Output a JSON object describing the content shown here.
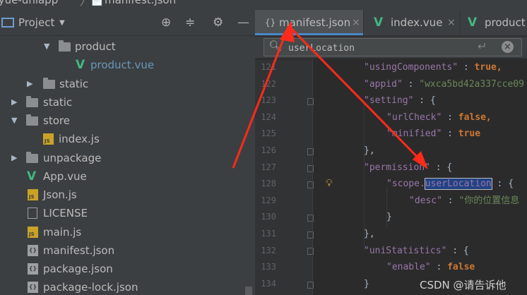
{
  "titlebar": {
    "project_name": "kaiyue-uniapp",
    "file_name": "manifest.json"
  },
  "project_pane": {
    "title": "Project",
    "tree": [
      {
        "label": "product",
        "kind": "folder",
        "expanded": true
      },
      {
        "label": "product.vue",
        "kind": "vue",
        "selected": true
      },
      {
        "label": "static",
        "kind": "folder",
        "expanded": false
      },
      {
        "label": "static",
        "kind": "folder",
        "expanded": false
      },
      {
        "label": "store",
        "kind": "folder",
        "expanded": true
      },
      {
        "label": "index.js",
        "kind": "js"
      },
      {
        "label": "unpackage",
        "kind": "folder",
        "expanded": false
      },
      {
        "label": "App.vue",
        "kind": "vue"
      },
      {
        "label": "Json.js",
        "kind": "js"
      },
      {
        "label": "LICENSE",
        "kind": "text"
      },
      {
        "label": "main.js",
        "kind": "js"
      },
      {
        "label": "manifest.json",
        "kind": "json"
      },
      {
        "label": "package.json",
        "kind": "json"
      },
      {
        "label": "package-lock.json",
        "kind": "json"
      }
    ]
  },
  "tabs": [
    {
      "label": "manifest.json",
      "active": true
    },
    {
      "label": "index.vue",
      "active": false
    },
    {
      "label": "product",
      "active": false
    }
  ],
  "search": {
    "value": "userLocation"
  },
  "editor": {
    "line_numbers": [
      "121",
      "122",
      "123",
      "124",
      "125",
      "126",
      "127",
      "128",
      "129",
      "130",
      "131",
      "132",
      "133",
      "134"
    ],
    "lines": [
      {
        "key": "usingComponents",
        "value": "true,"
      },
      {
        "key": "appid",
        "value": "\"wxca5bd42a337cce09"
      },
      {
        "key": "setting",
        "value": "{"
      },
      {
        "key": "urlCheck",
        "value": "false,"
      },
      {
        "key": "minified",
        "value": "true"
      },
      {
        "text": "},"
      },
      {
        "key": "permission",
        "value": "{"
      },
      {
        "key_prefix": "scope.",
        "key_match": "userLocation",
        "value": "{"
      },
      {
        "key": "desc",
        "value": "\"你的位置信息"
      },
      {
        "text": "}"
      },
      {
        "text": "},"
      },
      {
        "key": "uniStatistics",
        "value": "{"
      },
      {
        "key": "enable",
        "value": "false"
      },
      {
        "text": "}"
      }
    ]
  },
  "watermark": "CSDN @请告诉他",
  "colors": {
    "annotation_arrow": "#ff2a1a",
    "active_tab_underline": "#4a88c7"
  }
}
